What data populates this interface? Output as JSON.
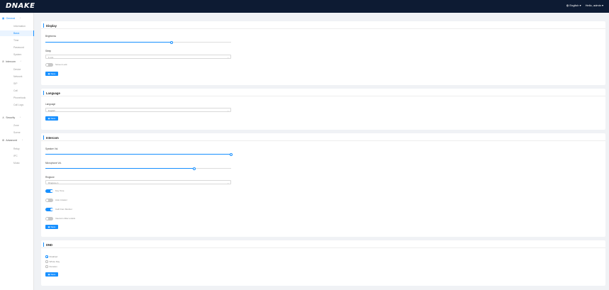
{
  "header": {
    "logo": "DNAKE",
    "language": "English",
    "greeting": "Hello, admin"
  },
  "sidebar": {
    "groups": [
      {
        "label": "General",
        "icon": "grid-icon",
        "items": [
          "Information",
          "Basic",
          "Time",
          "Password",
          "System"
        ]
      },
      {
        "label": "Intercom",
        "icon": "phone-icon",
        "items": [
          "Device",
          "Network",
          "SIP",
          "Call",
          "Phonebook",
          "Call Logs"
        ]
      },
      {
        "label": "Security",
        "icon": "person-icon",
        "items": [
          "Zone",
          "Scene"
        ]
      },
      {
        "label": "Advanced",
        "icon": "gear-icon",
        "items": [
          "Relay",
          "IPC",
          "Music"
        ]
      }
    ],
    "active_item": "Basic"
  },
  "display": {
    "title": "Display",
    "brightness_label": "Brightness",
    "brightness_value": 0.68,
    "sleep_label": "Sleep",
    "sleep_value": "1 min",
    "screen_lock_label": "Screen Lock",
    "screen_lock_on": false,
    "save_label": "Save"
  },
  "language": {
    "title": "Language",
    "language_label": "Language",
    "language_value": "English",
    "save_label": "Save"
  },
  "intercom": {
    "title": "Intercom",
    "speaker_label": "Speaker Vol.",
    "speaker_value": 1.0,
    "microphone_label": "Microphone Vol.",
    "microphone_value": 0.8,
    "ringtone_label": "Ringtone",
    "ringtone_value": "Ringtone 1",
    "toggles": [
      {
        "label": "Key Tone",
        "on": true
      },
      {
        "label": "Auto Answer",
        "on": false
      },
      {
        "label": "Call From Monitor",
        "on": true
      },
      {
        "label": "Intercom After unlock",
        "on": false
      }
    ],
    "save_label": "Save"
  },
  "dnd": {
    "title": "DND",
    "options": [
      "Disabled",
      "Whole Day",
      "Duration"
    ],
    "selected": "Disabled",
    "save_label": "Save"
  },
  "colors": {
    "accent": "#1890ff",
    "topbar": "#0d1b33",
    "background": "#f0f2f5"
  }
}
